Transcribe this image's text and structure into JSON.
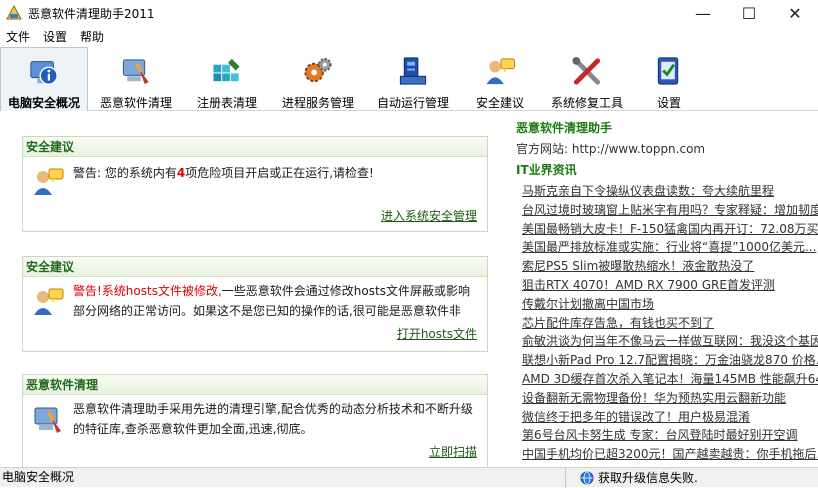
{
  "window": {
    "title": "恶意软件清理助手2011",
    "minimize": "—",
    "maximize": "☐",
    "close": "✕"
  },
  "menu": [
    "文件",
    "设置",
    "帮助"
  ],
  "toolbar": [
    {
      "label": "电脑安全概况",
      "icon": "computer-info-icon",
      "active": true
    },
    {
      "label": "恶意软件清理",
      "icon": "malware-clean-icon"
    },
    {
      "label": "注册表清理",
      "icon": "registry-clean-icon"
    },
    {
      "label": "进程服务管理",
      "icon": "process-service-icon"
    },
    {
      "label": "自动运行管理",
      "icon": "autorun-icon"
    },
    {
      "label": "安全建议",
      "icon": "security-advice-icon"
    },
    {
      "label": "系统修复工具",
      "icon": "repair-tools-icon"
    },
    {
      "label": "设置",
      "icon": "settings-icon"
    }
  ],
  "cards": [
    {
      "title": "安全建议",
      "text_pre": "警告: 您的系统内有",
      "text_num": "4",
      "text_post": "项危险项目开启或正在运行,请检查!",
      "link": "进入系统安全管理"
    },
    {
      "title": "安全建议",
      "text_warn": "警告!系统hosts文件被修改,",
      "text_rest": "一些恶意软件会通过修改hosts文件屏蔽或影响部分网络的正常访问。如果这不是您已知的操作的话,很可能是恶意软件非",
      "link": "打开hosts文件"
    },
    {
      "title": "恶意软件清理",
      "text": "恶意软件清理助手采用先进的清理引擎,配合优秀的动态分析技术和不断升级的特征库,查杀恶意软件更加全面,迅速,彻底。",
      "link": "立即扫描"
    }
  ],
  "right": {
    "title": "恶意软件清理助手",
    "site": "官方网站: http://www.toppn.com",
    "news_title": "IT业界资讯",
    "news": [
      "马斯克亲自下令操纵仪表盘读数：夸大续航里程",
      "台风过境时玻璃窗上贴米字有用吗？专家释疑：增加韧度",
      "美国最畅销大皮卡！F-150猛禽国内再开订：72.08万买...",
      "美国最严排放标准或实施：行业将“喜提”1000亿美元...",
      "索尼PS5 Slim被曝散热缩水！液金散热没了",
      "狙击RTX 4070！AMD RX 7900 GRE首发评测",
      "传戴尔计划撤离中国市场",
      "芯片配件库存告急，有钱也买不到了",
      "俞敏洪谈为何当年不像马云一样做互联网：我没这个基因",
      "联想小新Pad Pro 12.7配置揭晓：万金油骁龙870 价格...",
      "AMD 3D缓存首次杀入笔记本！海量145MB 性能飙升64",
      "设备翻新无需物理备份！华为预热实用云翻新功能",
      "微信终于把多年的错误改了！用户极易混淆",
      "第6号台风卡努生成 专家：台风登陆时最好别开空调",
      "中国手机均价已超3200元！国产越卖越贵：你手机拖后..."
    ]
  },
  "status": {
    "left": "电脑安全概况",
    "right": "获取升级信息失败."
  }
}
